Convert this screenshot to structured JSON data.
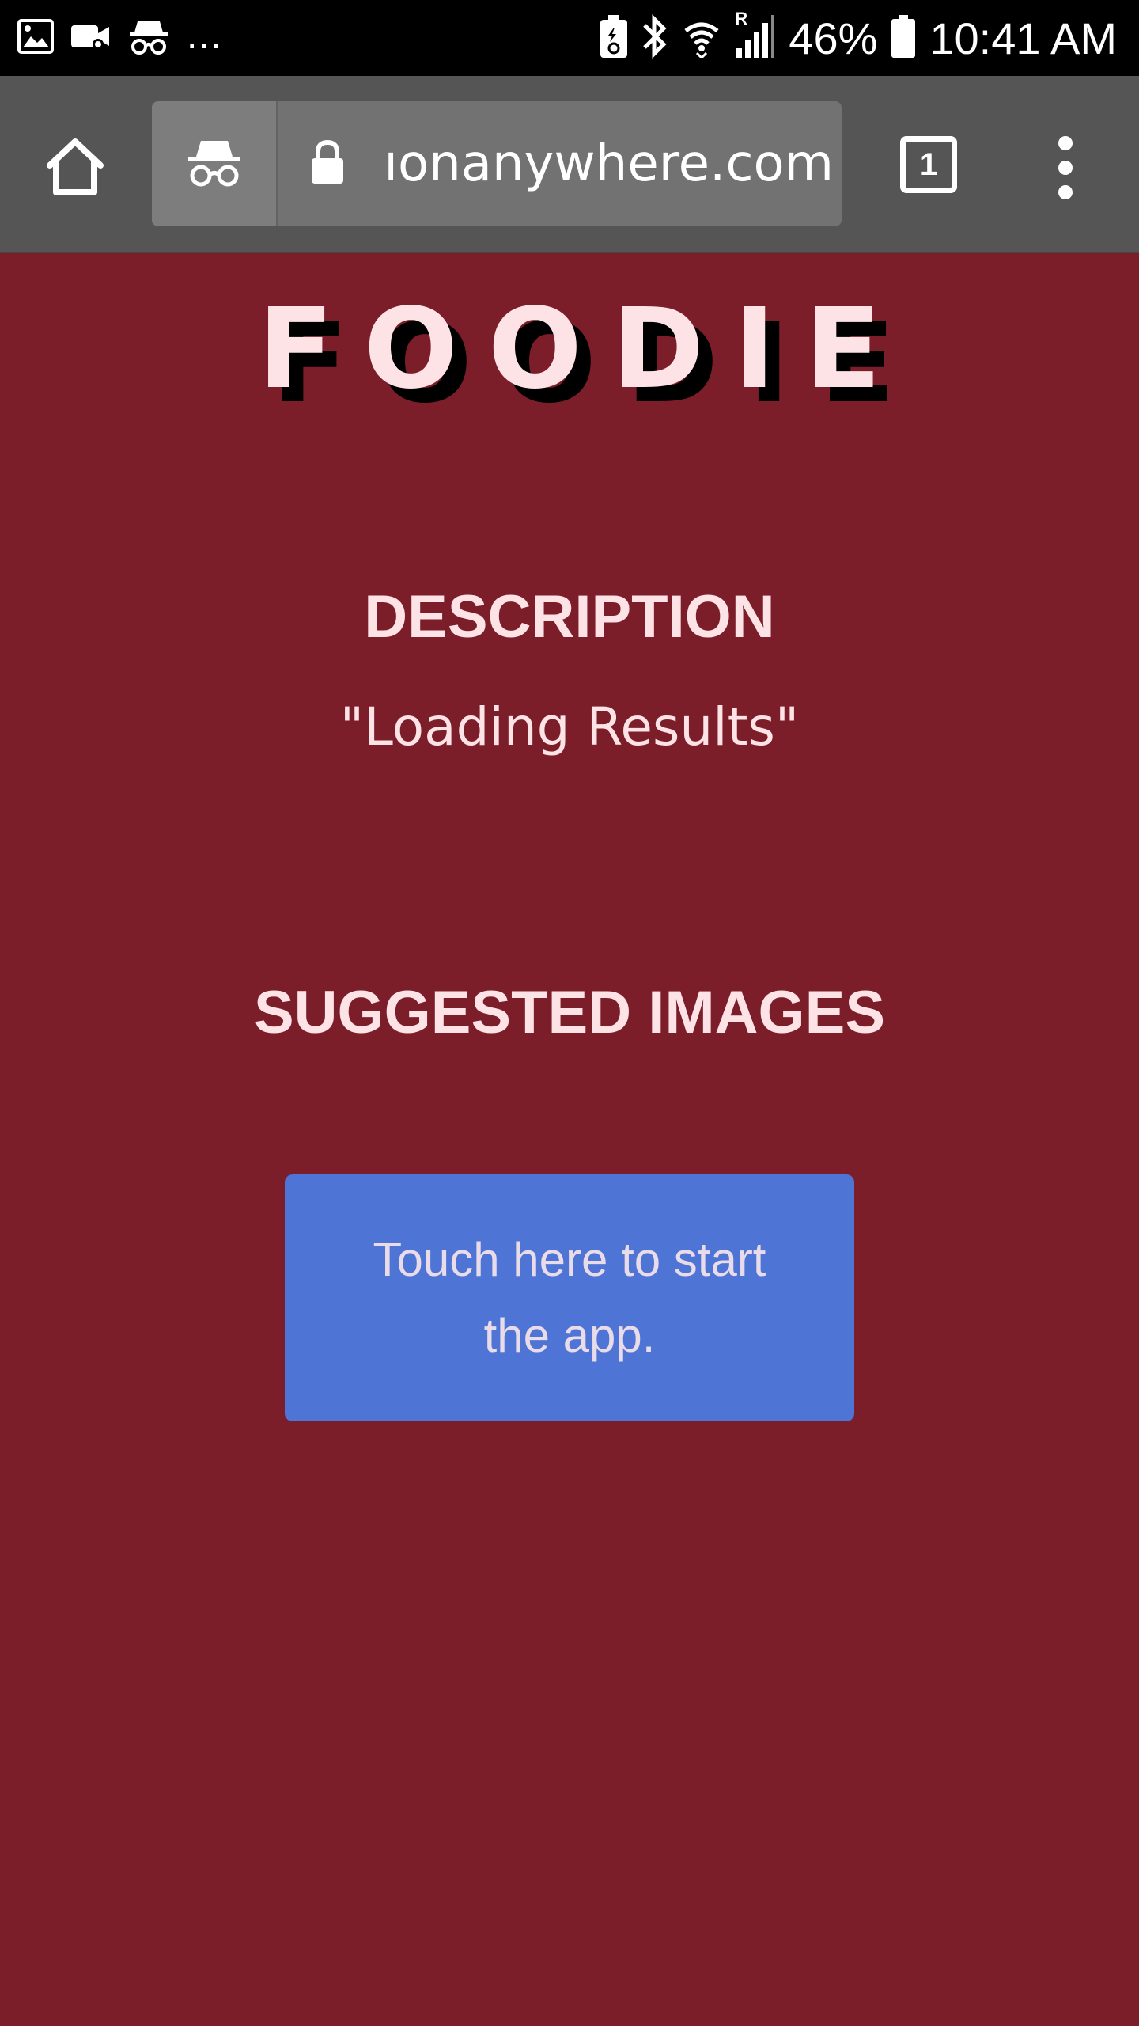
{
  "status_bar": {
    "left_icons": [
      "image-icon",
      "video-call-icon",
      "incognito-icon",
      "more-notifications-icon"
    ],
    "more_notifications": "...",
    "right_icons": [
      "battery-saver-icon",
      "bluetooth-icon",
      "wifi-icon",
      "signal-icon",
      "battery-icon"
    ],
    "roaming_label": "R",
    "battery_percent": "46%",
    "time": "10:41 AM"
  },
  "browser": {
    "home_icon": "home-icon",
    "incognito_icon": "incognito-icon",
    "lock_icon": "lock-icon",
    "url": "ıonanywhere.com",
    "tab_count": "1",
    "menu_icon": "kebab-menu-icon"
  },
  "page": {
    "logo": "FOODIE",
    "description_heading": "DESCRIPTION",
    "description_text": "\"Loading Results\"",
    "suggested_heading": "SUGGESTED IMAGES",
    "start_button_label": "Touch here to start the app."
  },
  "colors": {
    "page_background": "#7b1e2a",
    "heading_text": "#fde3e6",
    "button_background": "#4e75d5",
    "toolbar_background": "#555555",
    "status_bar_background": "#000000"
  }
}
